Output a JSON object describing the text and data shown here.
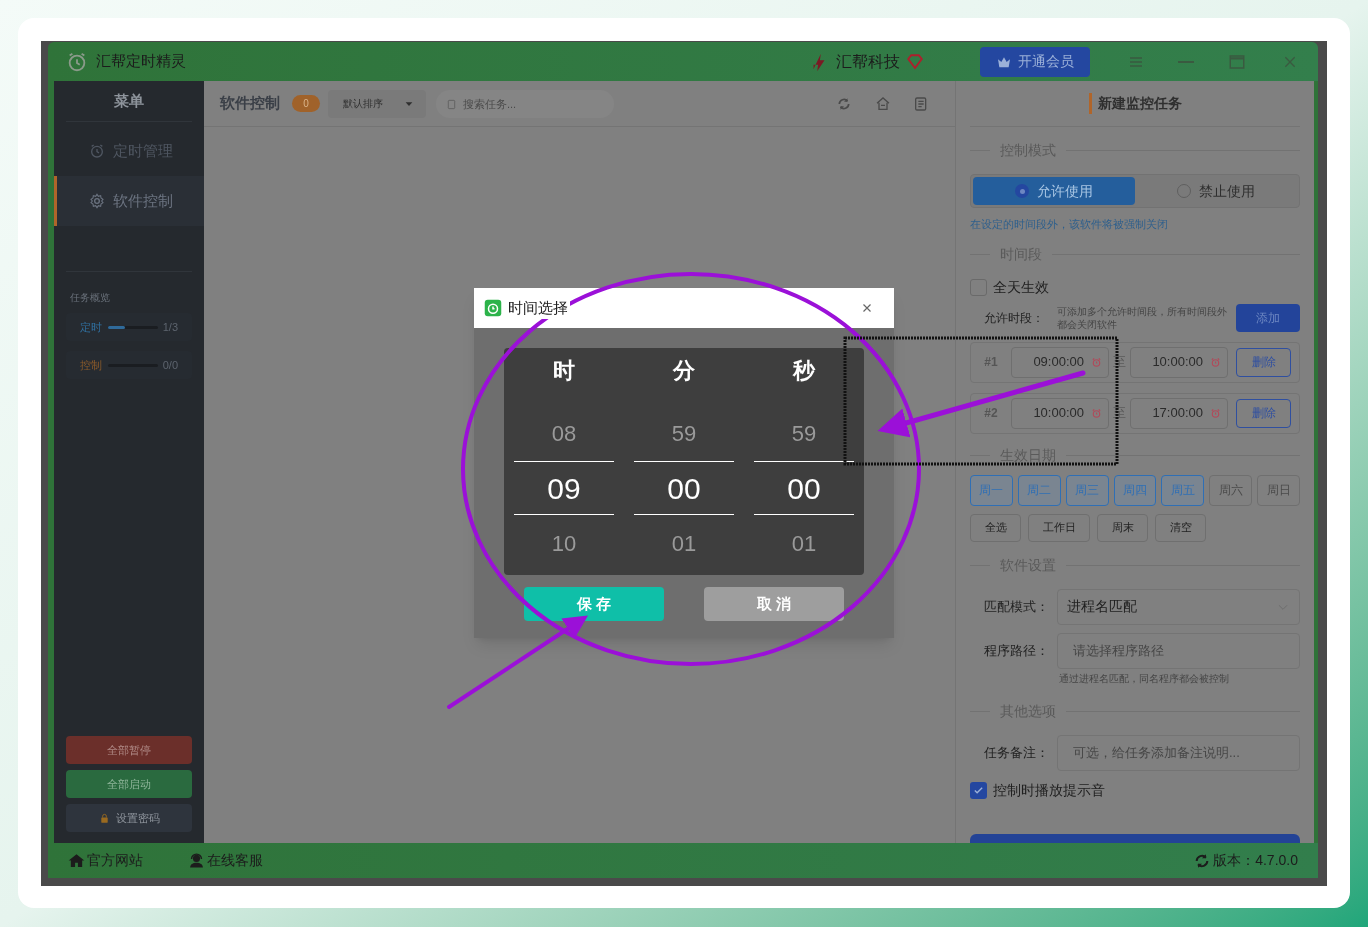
{
  "window": {
    "title": "汇帮定时精灵",
    "brand": "汇帮科技",
    "vip_button": "开通会员"
  },
  "sidebar": {
    "heading": "菜单",
    "items": [
      {
        "label": "定时管理",
        "selected": false
      },
      {
        "label": "软件控制",
        "selected": true
      }
    ],
    "overview": {
      "heading": "任务概览",
      "rows": [
        {
          "label": "定时",
          "level": 0.33,
          "count": "1/3",
          "color": "#2f6f9f"
        },
        {
          "label": "控制",
          "count": "0/0",
          "color": "#8a5a2a"
        }
      ]
    },
    "buttons": [
      {
        "label": "全部暂停",
        "kind": "danger"
      },
      {
        "label": "全部启动",
        "kind": "success"
      },
      {
        "label": "设置密码",
        "kind": "lock"
      }
    ]
  },
  "toolbar": {
    "title": "软件控制",
    "count": "0",
    "sort": "默认排序",
    "search_placeholder": "搜索任务..."
  },
  "panel": {
    "title": "新建监控任务",
    "mode": {
      "heading": "控制模式",
      "options": [
        {
          "label": "允许使用",
          "selected": true
        },
        {
          "label": "禁止使用",
          "selected": false
        }
      ],
      "hint": "在设定的时间段外，该软件将被强制关闭"
    },
    "period": {
      "heading": "时间段",
      "all_day": {
        "label": "全天生效",
        "checked": false
      },
      "slots_label": "允许时段：",
      "slots_hint": "可添加多个允许时间段，所有时间段外都会关闭软件",
      "add": "添加",
      "slots": [
        {
          "index": "#1",
          "start": "09:00:00",
          "sep": "至",
          "end": "10:00:00",
          "delete": "删除"
        },
        {
          "index": "#2",
          "start": "10:00:00",
          "sep": "至",
          "end": "17:00:00",
          "delete": "删除"
        }
      ]
    },
    "dates": {
      "heading": "生效日期",
      "days": [
        {
          "label": "周一",
          "selected": true
        },
        {
          "label": "周二",
          "selected": true
        },
        {
          "label": "周三",
          "selected": true
        },
        {
          "label": "周四",
          "selected": true
        },
        {
          "label": "周五",
          "selected": true
        },
        {
          "label": "周六",
          "selected": false
        },
        {
          "label": "周日",
          "selected": false
        }
      ],
      "quick": [
        "全选",
        "工作日",
        "周末",
        "清空"
      ]
    },
    "software": {
      "heading": "软件设置",
      "match_label": "匹配模式：",
      "match_value": "进程名匹配",
      "path_label": "程序路径：",
      "path_placeholder": "请选择程序路径",
      "path_hint": "通过进程名匹配，同名程序都会被控制"
    },
    "other": {
      "heading": "其他选项",
      "note_label": "任务备注：",
      "note_placeholder": "可选，给任务添加备注说明...",
      "sound": {
        "label": "控制时播放提示音",
        "checked": true
      }
    }
  },
  "footer": {
    "links": [
      "官方网站",
      "在线客服"
    ],
    "version": "版本：4.7.0.0"
  },
  "dialog": {
    "title": "时间选择",
    "columns": [
      {
        "heading": "时",
        "above": "08",
        "value": "09",
        "below": "10"
      },
      {
        "heading": "分",
        "above": "59",
        "value": "00",
        "below": "01"
      },
      {
        "heading": "秒",
        "above": "59",
        "value": "00",
        "below": "01"
      }
    ],
    "save": "保 存",
    "cancel": "取 消"
  }
}
